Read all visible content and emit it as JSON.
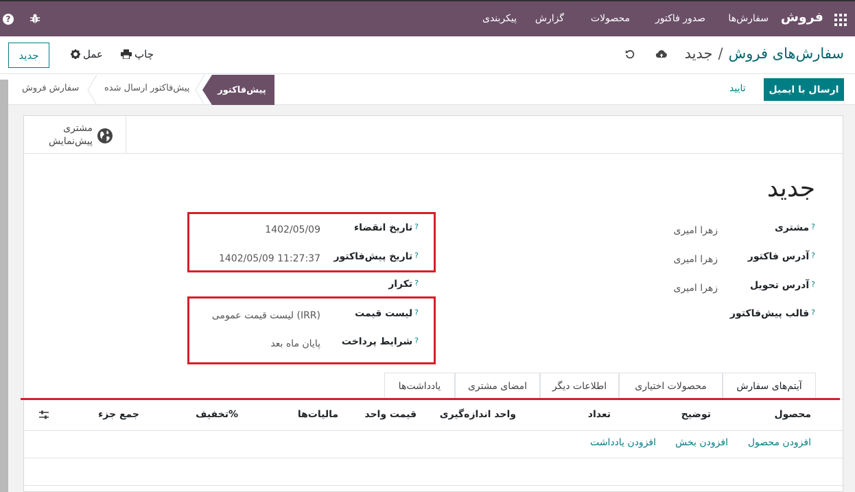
{
  "navbar": {
    "brand": "فروش",
    "menu": [
      "سفارش‌ها",
      "صدور فاکتور",
      "محصولات",
      "گزارش",
      "پیکربندی"
    ],
    "apps_icon": "grid-icon",
    "help_icon": "?",
    "debug_icon": "bug-icon"
  },
  "control_panel": {
    "breadcrumb_parent": "سفارش‌های فروش",
    "breadcrumb_separator": "/",
    "breadcrumb_current": "جدید",
    "new_button": "جدید",
    "print_label": "چاپ",
    "action_label": "عمل"
  },
  "status_bar": {
    "send_email": "ارسال با ایمیل",
    "confirm": "تایید",
    "stages": [
      "پیش‌فاکتور",
      "پیش‌فاکتور ارسال شده",
      "سفارش فروش"
    ],
    "active_stage": "پیش‌فاکتور"
  },
  "smart_button": {
    "line1": "مشتری",
    "line2": "پیش‌نمایش"
  },
  "form": {
    "title": "جدید",
    "customer_label": "مشتری",
    "customer_value": "زهرا امیری",
    "invoice_address_label": "آدرس فاکتور",
    "invoice_address_value": "زهرا امیری",
    "delivery_address_label": "آدرس تحویل",
    "delivery_address_value": "زهرا امیری",
    "quote_template_label": "قالب پیش‌فاکتور",
    "expiration_label": "تاریخ انقضاء",
    "expiration_value": "1402/05/09",
    "quotation_date_label": "تاریخ پیش‌فاکتور",
    "quotation_date_value": "1402/05/09 11:27:37",
    "recurrence_label": "تکرار",
    "pricelist_label": "لیست قیمت",
    "pricelist_value": "لیست قیمت عمومی (IRR)",
    "payment_terms_label": "شرایط پرداخت",
    "payment_terms_value": "پایان ماه بعد",
    "help_mark": "?"
  },
  "tabs": [
    "آیتم‌های سفارش",
    "محصولات اختیاری",
    "اطلاعات دیگر",
    "امضای مشتری",
    "یادداشت‌ها"
  ],
  "order_lines": {
    "columns": [
      "محصول",
      "توضیح",
      "تعداد",
      "واحد اندازه‌گیری",
      "قیمت واحد",
      "مالیات‌ها",
      "تخفیف%",
      "جمع جزء"
    ],
    "add_product": "افزودن محصول",
    "add_section": "افزودن بخش",
    "add_note": "افزودن یادداشت"
  },
  "colors": {
    "navbar": "#6b4f67",
    "primary": "#017e84",
    "highlight": "#d61f28"
  }
}
